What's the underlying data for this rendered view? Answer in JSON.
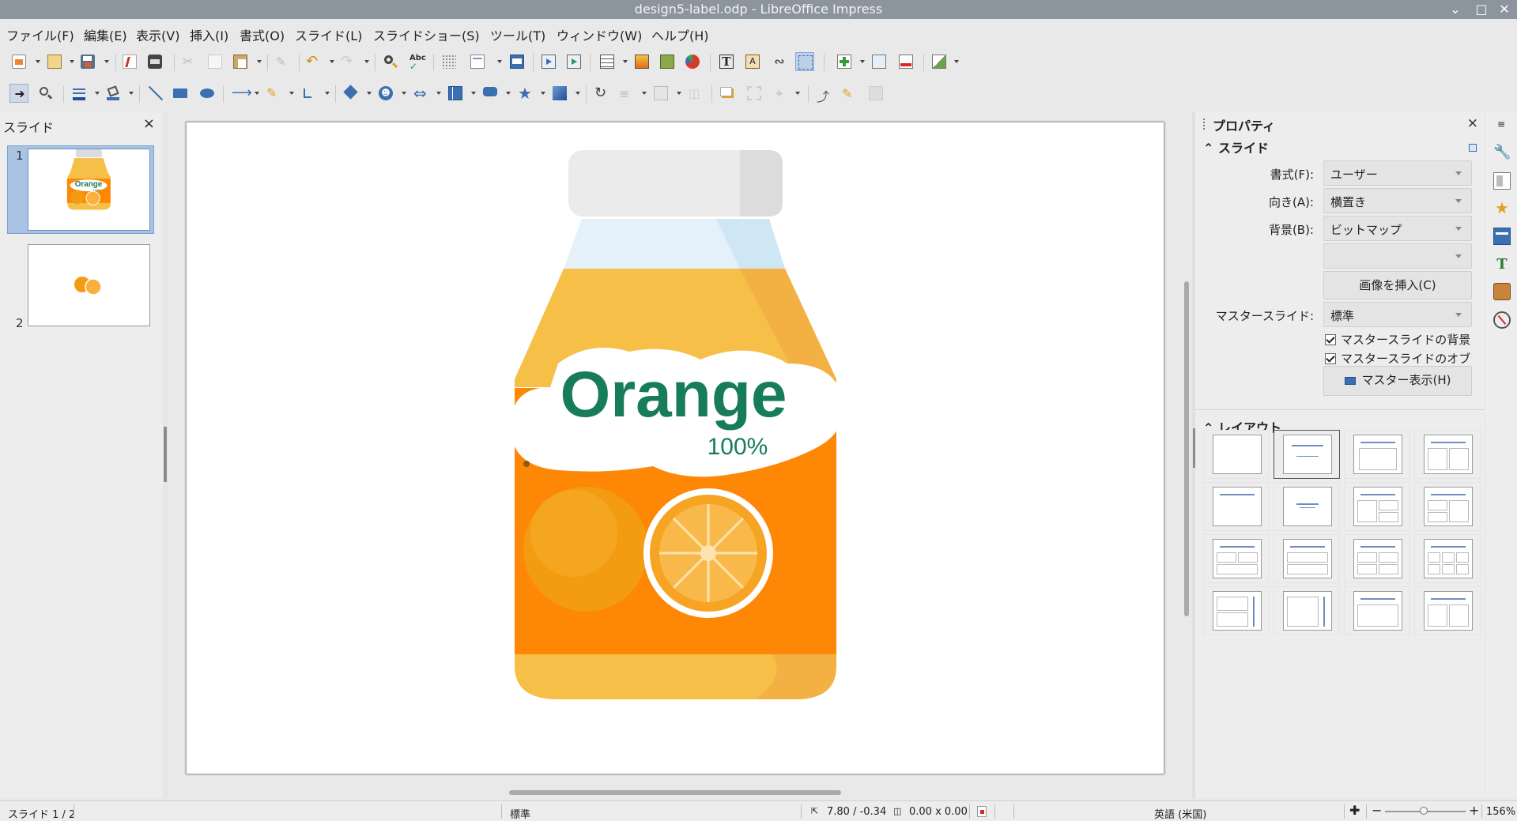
{
  "window": {
    "title": "design5-label.odp - LibreOffice Impress"
  },
  "menu": [
    "ファイル(F)",
    "編集(E)",
    "表示(V)",
    "挿入(I)",
    "書式(O)",
    "スライド(L)",
    "スライドショー(S)",
    "ツール(T)",
    "ウィンドウ(W)",
    "ヘルプ(H)"
  ],
  "slides_panel": {
    "title": "スライド",
    "close": "×",
    "numbers": [
      "1",
      "2"
    ]
  },
  "slide": {
    "label_word": "Orange",
    "label_percent": "100%"
  },
  "thumb1": {
    "word": "Orange",
    "pct": "100%"
  },
  "properties": {
    "title": "プロパティ",
    "close": "×",
    "slide_section": "スライド",
    "format_label": "書式(F):",
    "format_value": "ユーザー",
    "orientation_label": "向き(A):",
    "orientation_value": "横置き",
    "background_label": "背景(B):",
    "background_value": "ビットマップ",
    "bitmap_value": "",
    "insert_image": "画像を挿入(C)",
    "master_label": "マスタースライド:",
    "master_value": "標準",
    "check1": "マスタースライドの背景",
    "check2": "マスタースライドのオブジェクト",
    "master_view": "マスター表示(H)",
    "layout_section": "レイアウト"
  },
  "status": {
    "slide": "スライド 1 / 2",
    "master": "標準",
    "position": "7.80 / -0.34",
    "size": "0.00 x 0.00",
    "language": "英語 (米国)",
    "zoom": "156%"
  },
  "colors": {
    "orange_label": "#fe8706",
    "green_text": "#177c5c",
    "juice": "#f6bf48"
  }
}
